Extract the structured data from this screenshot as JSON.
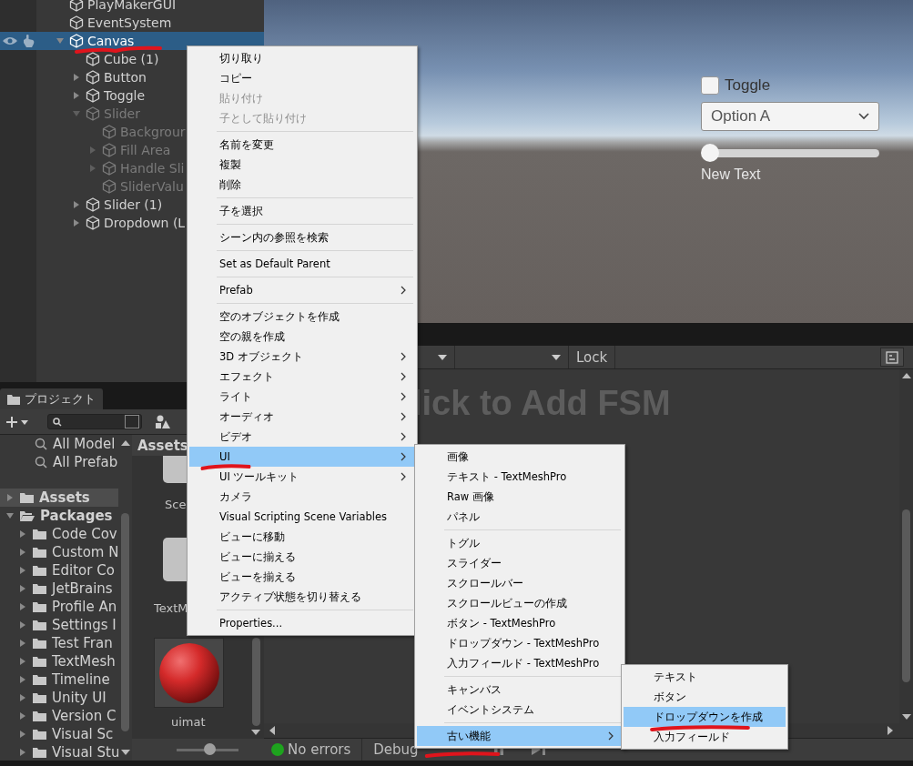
{
  "hierarchy": {
    "items": [
      {
        "label": "PlayMakerGUI",
        "kind": "leaf",
        "selected": false,
        "disabled": false
      },
      {
        "label": "EventSystem",
        "kind": "leaf",
        "selected": false,
        "disabled": false
      },
      {
        "label": "Canvas",
        "kind": "group",
        "expanded": true,
        "selected": true,
        "disabled": false,
        "underlined": true,
        "children": [
          {
            "label": "Cube (1)",
            "kind": "leaf",
            "selected": false,
            "disabled": false
          },
          {
            "label": "Button",
            "kind": "group",
            "expanded": false,
            "selected": false,
            "disabled": false
          },
          {
            "label": "Toggle",
            "kind": "group",
            "expanded": false,
            "selected": false,
            "disabled": false
          },
          {
            "label": "Slider",
            "kind": "group",
            "expanded": true,
            "selected": false,
            "disabled": true,
            "children": [
              {
                "label": "Backgrour",
                "kind": "leaf",
                "selected": false,
                "disabled": true
              },
              {
                "label": "Fill Area",
                "kind": "group",
                "expanded": false,
                "selected": false,
                "disabled": true
              },
              {
                "label": "Handle Sli",
                "kind": "group",
                "expanded": false,
                "selected": false,
                "disabled": true
              },
              {
                "label": "SliderValu",
                "kind": "leaf",
                "selected": false,
                "disabled": true
              }
            ]
          },
          {
            "label": "Slider (1)",
            "kind": "group",
            "expanded": false,
            "selected": false,
            "disabled": false
          },
          {
            "label": "Dropdown (L",
            "kind": "group",
            "expanded": false,
            "selected": false,
            "disabled": false
          }
        ]
      }
    ]
  },
  "scene": {
    "toggle": {
      "label": "Toggle",
      "checked": false
    },
    "dropdown": {
      "value": "Option A"
    },
    "slider": {
      "level": 0
    },
    "text": "New Text"
  },
  "project": {
    "tab": "プロジェクト",
    "tree": [
      {
        "label": "All Model",
        "kind": "search",
        "selected": false
      },
      {
        "label": "All Prefab",
        "kind": "search",
        "selected": false
      },
      {
        "label": "Assets",
        "kind": "root",
        "expanded": false,
        "selected": true
      },
      {
        "label": "Packages",
        "kind": "root",
        "expanded": true,
        "selected": false,
        "children": [
          {
            "label": "Code Cov",
            "kind": "folder",
            "expanded": false,
            "selected": false
          },
          {
            "label": "Custom N",
            "kind": "folder",
            "expanded": false,
            "selected": false
          },
          {
            "label": "Editor Co",
            "kind": "folder",
            "expanded": false,
            "selected": false
          },
          {
            "label": "JetBrains",
            "kind": "folder",
            "expanded": false,
            "selected": false
          },
          {
            "label": "Profile An",
            "kind": "folder",
            "expanded": false,
            "selected": false
          },
          {
            "label": "Settings I",
            "kind": "folder",
            "expanded": false,
            "selected": false
          },
          {
            "label": "Test Fran",
            "kind": "folder",
            "expanded": false,
            "selected": false
          },
          {
            "label": "TextMesh",
            "kind": "folder",
            "expanded": false,
            "selected": false
          },
          {
            "label": "Timeline",
            "kind": "folder",
            "expanded": false,
            "selected": false
          },
          {
            "label": "Unity UI",
            "kind": "folder",
            "expanded": false,
            "selected": false
          },
          {
            "label": "Version C",
            "kind": "folder",
            "expanded": false,
            "selected": false
          },
          {
            "label": "Visual Sc",
            "kind": "folder",
            "expanded": false,
            "selected": false
          },
          {
            "label": "Visual Stu",
            "kind": "folder",
            "expanded": false,
            "selected": false
          }
        ]
      }
    ],
    "breadcrumb": "Assets",
    "zoom": {
      "level": 0.55
    },
    "assets": [
      {
        "label": "Sce",
        "kind": "blank"
      },
      {
        "label": "TextM",
        "kind": "blank"
      },
      {
        "label": "uimat",
        "kind": "material"
      }
    ]
  },
  "playmaker": {
    "lock": "Lock",
    "hint": "lick to Add FSM",
    "errors": "No errors",
    "debug": "Debug"
  },
  "menus": [
    {
      "items": [
        {
          "kind": "item",
          "label": "切り取り",
          "disabled": false,
          "selected": false,
          "submenu": false
        },
        {
          "kind": "item",
          "label": "コピー",
          "disabled": false,
          "selected": false,
          "submenu": false
        },
        {
          "kind": "item",
          "label": "貼り付け",
          "disabled": true,
          "selected": false,
          "submenu": false
        },
        {
          "kind": "item",
          "label": "子として貼り付け",
          "disabled": true,
          "selected": false,
          "submenu": false
        },
        {
          "kind": "separator"
        },
        {
          "kind": "item",
          "label": "名前を変更",
          "disabled": false,
          "selected": false,
          "submenu": false
        },
        {
          "kind": "item",
          "label": "複製",
          "disabled": false,
          "selected": false,
          "submenu": false
        },
        {
          "kind": "item",
          "label": "削除",
          "disabled": false,
          "selected": false,
          "submenu": false
        },
        {
          "kind": "separator"
        },
        {
          "kind": "item",
          "label": "子を選択",
          "disabled": false,
          "selected": false,
          "submenu": false
        },
        {
          "kind": "separator"
        },
        {
          "kind": "item",
          "label": "シーン内の参照を検索",
          "disabled": false,
          "selected": false,
          "submenu": false
        },
        {
          "kind": "separator"
        },
        {
          "kind": "item",
          "label": "Set as Default Parent",
          "disabled": false,
          "selected": false,
          "submenu": false
        },
        {
          "kind": "separator"
        },
        {
          "kind": "item",
          "label": "Prefab",
          "disabled": false,
          "selected": false,
          "submenu": true
        },
        {
          "kind": "separator"
        },
        {
          "kind": "item",
          "label": "空のオブジェクトを作成",
          "disabled": false,
          "selected": false,
          "submenu": false
        },
        {
          "kind": "item",
          "label": "空の親を作成",
          "disabled": false,
          "selected": false,
          "submenu": false
        },
        {
          "kind": "item",
          "label": "3D オブジェクト",
          "disabled": false,
          "selected": false,
          "submenu": true
        },
        {
          "kind": "item",
          "label": "エフェクト",
          "disabled": false,
          "selected": false,
          "submenu": true
        },
        {
          "kind": "item",
          "label": "ライト",
          "disabled": false,
          "selected": false,
          "submenu": true
        },
        {
          "kind": "item",
          "label": "オーディオ",
          "disabled": false,
          "selected": false,
          "submenu": true
        },
        {
          "kind": "item",
          "label": "ビデオ",
          "disabled": false,
          "selected": false,
          "submenu": true
        },
        {
          "kind": "item",
          "label": "UI",
          "disabled": false,
          "selected": true,
          "submenu": true,
          "underlined": true
        },
        {
          "kind": "item",
          "label": "UI ツールキット",
          "disabled": false,
          "selected": false,
          "submenu": true
        },
        {
          "kind": "item",
          "label": "カメラ",
          "disabled": false,
          "selected": false,
          "submenu": false
        },
        {
          "kind": "item",
          "label": "Visual Scripting Scene Variables",
          "disabled": false,
          "selected": false,
          "submenu": false
        },
        {
          "kind": "item",
          "label": "ビューに移動",
          "disabled": false,
          "selected": false,
          "submenu": false
        },
        {
          "kind": "item",
          "label": "ビューに揃える",
          "disabled": false,
          "selected": false,
          "submenu": false
        },
        {
          "kind": "item",
          "label": "ビューを揃える",
          "disabled": false,
          "selected": false,
          "submenu": false
        },
        {
          "kind": "item",
          "label": "アクティブ状態を切り替える",
          "disabled": false,
          "selected": false,
          "submenu": false
        },
        {
          "kind": "separator"
        },
        {
          "kind": "item",
          "label": "Properties...",
          "disabled": false,
          "selected": false,
          "submenu": false
        }
      ]
    },
    {
      "items": [
        {
          "kind": "item",
          "label": "画像",
          "disabled": false,
          "selected": false,
          "submenu": false
        },
        {
          "kind": "item",
          "label": "テキスト - TextMeshPro",
          "disabled": false,
          "selected": false,
          "submenu": false
        },
        {
          "kind": "item",
          "label": "Raw 画像",
          "disabled": false,
          "selected": false,
          "submenu": false
        },
        {
          "kind": "item",
          "label": "パネル",
          "disabled": false,
          "selected": false,
          "submenu": false
        },
        {
          "kind": "separator"
        },
        {
          "kind": "item",
          "label": "トグル",
          "disabled": false,
          "selected": false,
          "submenu": false
        },
        {
          "kind": "item",
          "label": "スライダー",
          "disabled": false,
          "selected": false,
          "submenu": false
        },
        {
          "kind": "item",
          "label": "スクロールバー",
          "disabled": false,
          "selected": false,
          "submenu": false
        },
        {
          "kind": "item",
          "label": "スクロールビューの作成",
          "disabled": false,
          "selected": false,
          "submenu": false
        },
        {
          "kind": "item",
          "label": "ボタン - TextMeshPro",
          "disabled": false,
          "selected": false,
          "submenu": false
        },
        {
          "kind": "item",
          "label": "ドロップダウン - TextMeshPro",
          "disabled": false,
          "selected": false,
          "submenu": false
        },
        {
          "kind": "item",
          "label": "入力フィールド - TextMeshPro",
          "disabled": false,
          "selected": false,
          "submenu": false
        },
        {
          "kind": "separator"
        },
        {
          "kind": "item",
          "label": "キャンバス",
          "disabled": false,
          "selected": false,
          "submenu": false
        },
        {
          "kind": "item",
          "label": "イベントシステム",
          "disabled": false,
          "selected": false,
          "submenu": false
        },
        {
          "kind": "separator"
        },
        {
          "kind": "item",
          "label": "古い機能",
          "disabled": false,
          "selected": true,
          "submenu": true,
          "underlined": true
        }
      ]
    },
    {
      "items": [
        {
          "kind": "item",
          "label": "テキスト",
          "disabled": false,
          "selected": false,
          "submenu": false
        },
        {
          "kind": "item",
          "label": "ボタン",
          "disabled": false,
          "selected": false,
          "submenu": false
        },
        {
          "kind": "item",
          "label": "ドロップダウンを作成",
          "disabled": false,
          "selected": true,
          "submenu": false,
          "underlined": true
        },
        {
          "kind": "item",
          "label": "入力フィールド",
          "disabled": false,
          "selected": false,
          "submenu": false
        }
      ]
    }
  ]
}
